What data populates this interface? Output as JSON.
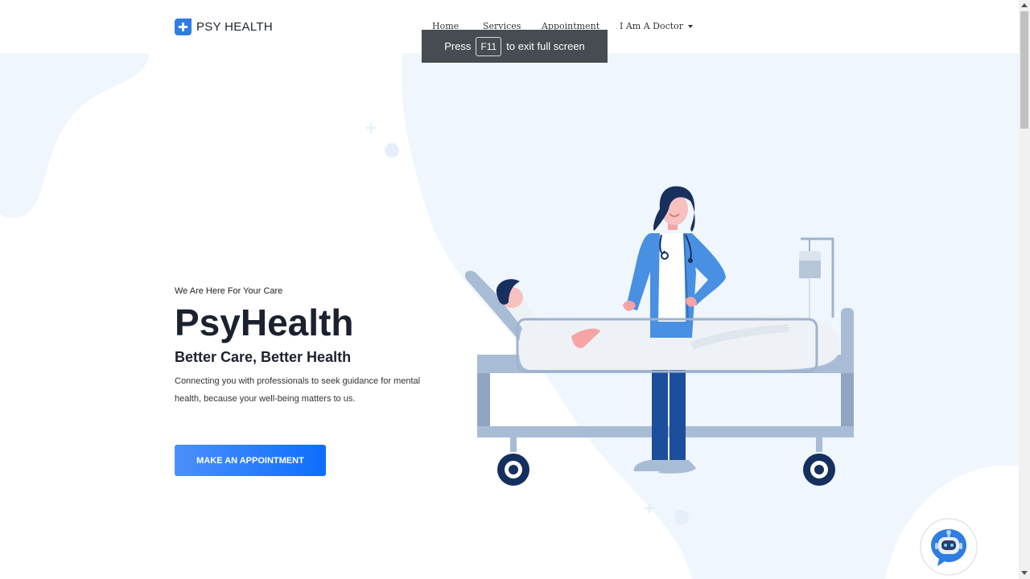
{
  "brand": {
    "name": "PSY HEALTH"
  },
  "nav": {
    "home": "Home",
    "services": "Services",
    "appointment": "Appointment",
    "doctor": "I Am A Doctor"
  },
  "fullscreen_toast": {
    "prefix": "Press",
    "key": "F11",
    "suffix": "to exit full screen"
  },
  "hero": {
    "tagline": "We Are Here For Your Care",
    "title": "PsyHealth",
    "subtitle": "Better Care, Better Health",
    "description": "Connecting you with professionals to seek guidance for mental health, because your well-being matters to us.",
    "cta": "MAKE AN APPOINTMENT"
  },
  "colors": {
    "accent": "#0d6efd",
    "blob": "#eff6fd",
    "illustration_blue": "#4a90e2"
  },
  "icons": [
    "medical-cross-icon",
    "caret-down-icon",
    "chatbot-icon"
  ]
}
